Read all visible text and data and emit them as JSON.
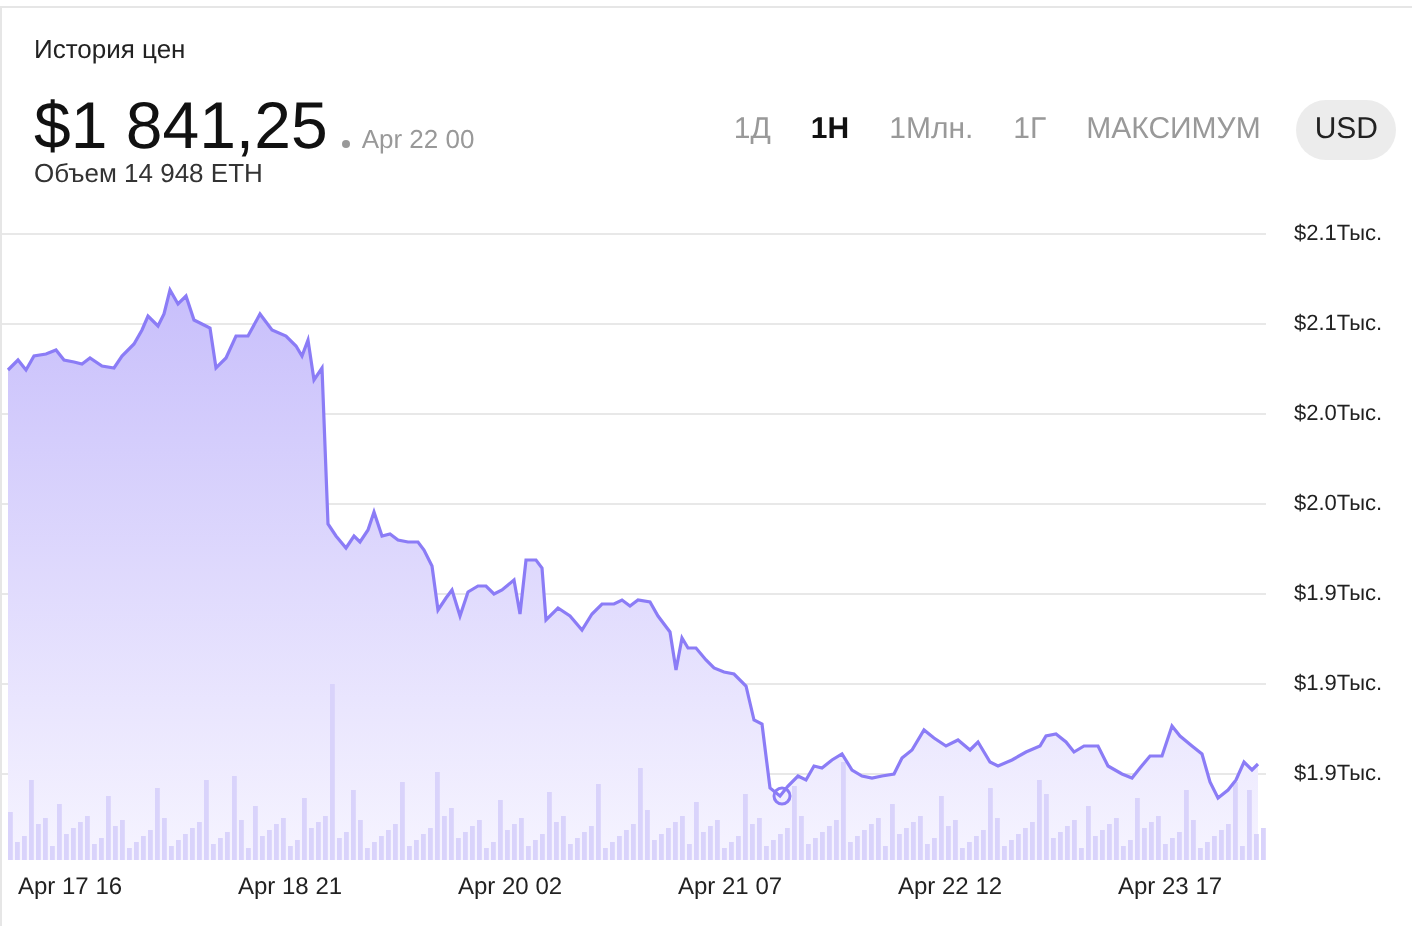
{
  "title": "История цен",
  "price": "$1 841,25",
  "timestamp": "Apr 22 00",
  "volume": "Объем 14 948 ETH",
  "ranges": [
    {
      "label": "1Д",
      "selected": false
    },
    {
      "label": "1Н",
      "selected": true
    },
    {
      "label": "1Млн.",
      "selected": false
    },
    {
      "label": "1Г",
      "selected": false
    },
    {
      "label": "МАКСИМУМ",
      "selected": false
    }
  ],
  "currency": "USD",
  "chart": {
    "y_labels": [
      "$2.1Тыс.",
      "$2.1Тыс.",
      "$2.0Тыс.",
      "$2.0Тыс.",
      "$1.9Тыс.",
      "$1.9Тыс.",
      "$1.9Тыс."
    ],
    "x_labels": [
      "Apr 17 16",
      "Apr 18 21",
      "Apr 20 02",
      "Apr 21 07",
      "Apr 22 12",
      "Apr 23 17"
    ]
  }
}
